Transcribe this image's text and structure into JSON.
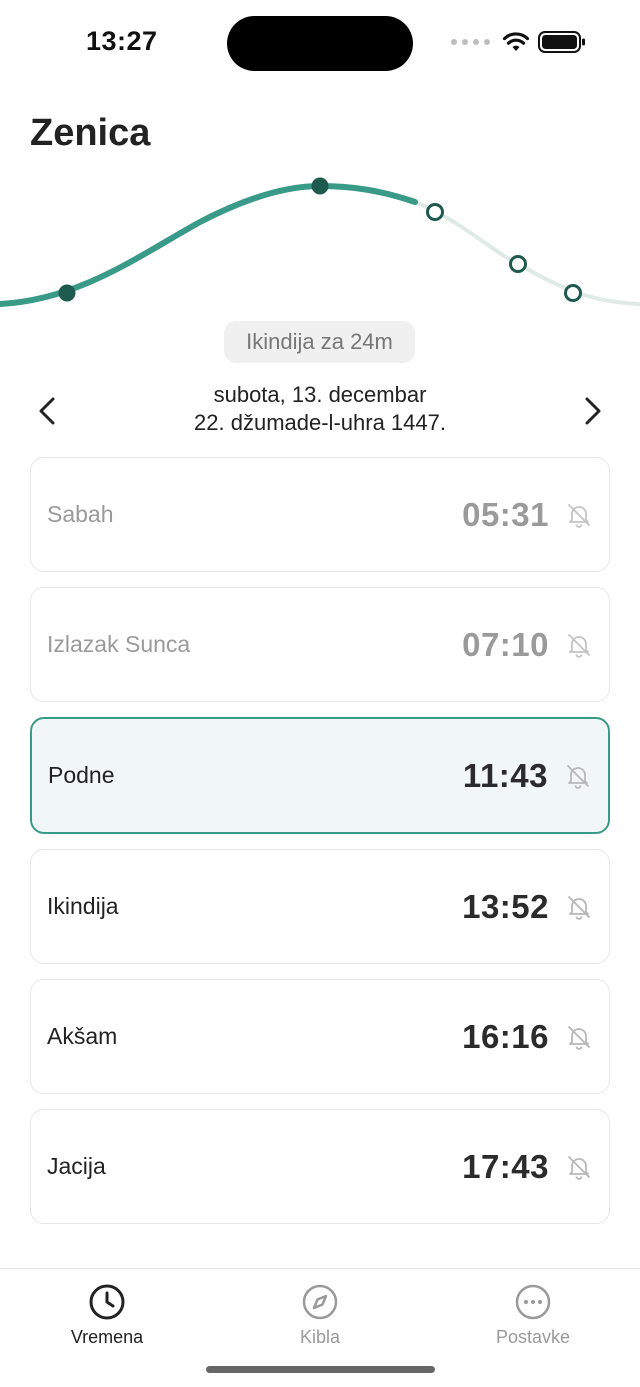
{
  "status_bar": {
    "time": "13:27"
  },
  "header": {
    "city": "Zenica"
  },
  "countdown": "Ikindija za 24m",
  "date": {
    "gregorian": "subota, 13. decembar",
    "hijri": "22. džumade-l-uhra 1447."
  },
  "prayers": [
    {
      "name": "Sabah",
      "time": "05:31",
      "state": "past",
      "bell_icon": "bell-off-icon"
    },
    {
      "name": "Izlazak Sunca",
      "time": "07:10",
      "state": "past",
      "bell_icon": "bell-off-icon"
    },
    {
      "name": "Podne",
      "time": "11:43",
      "state": "current",
      "bell_icon": "bell-off-icon"
    },
    {
      "name": "Ikindija",
      "time": "13:52",
      "state": "upcoming",
      "bell_icon": "bell-off-icon"
    },
    {
      "name": "Akšam",
      "time": "16:16",
      "state": "upcoming",
      "bell_icon": "bell-off-icon"
    },
    {
      "name": "Jacija",
      "time": "17:43",
      "state": "upcoming",
      "bell_icon": "bell-off-icon"
    }
  ],
  "tabs": [
    {
      "label": "Vremena",
      "icon": "clock-icon",
      "active": true
    },
    {
      "label": "Kibla",
      "icon": "compass-icon",
      "active": false
    },
    {
      "label": "Postavke",
      "icon": "more-icon",
      "active": false
    }
  ],
  "colors": {
    "accent": "#3a9a88",
    "accent_dark": "#1e5a4e",
    "curve_future": "#dfe9e6",
    "current_bg": "#f1f7f6"
  }
}
